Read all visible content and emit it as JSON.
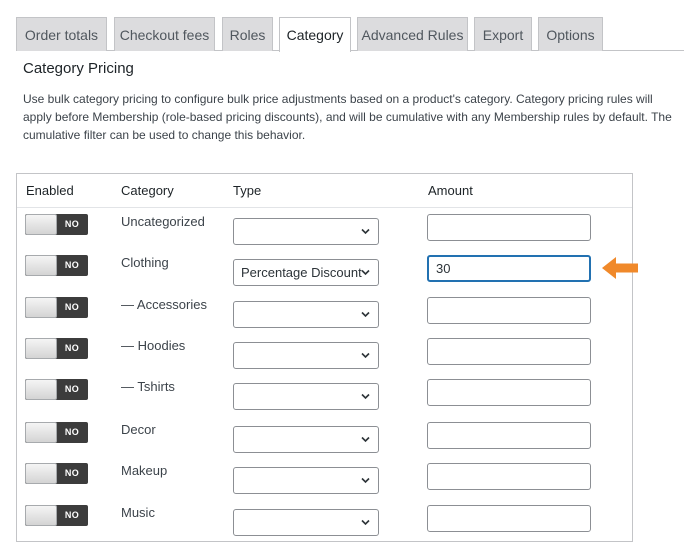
{
  "tabs": [
    {
      "label": "Order totals"
    },
    {
      "label": "Checkout fees"
    },
    {
      "label": "Roles"
    },
    {
      "label": "Category"
    },
    {
      "label": "Advanced Rules"
    },
    {
      "label": "Export"
    },
    {
      "label": "Options"
    }
  ],
  "active_tab": "Category",
  "section": {
    "title": "Category Pricing",
    "description": "Use bulk category pricing to configure bulk price adjustments based on a product's category. Category pricing rules will apply before Membership (role-based pricing discounts), and will be cumulative with any Membership rules by default. The cumulative filter can be used to change this behavior."
  },
  "table": {
    "headers": {
      "enabled": "Enabled",
      "category": "Category",
      "type": "Type",
      "amount": "Amount"
    },
    "toggle_off_label": "NO",
    "rows": [
      {
        "category": "Uncategorized",
        "enabled": false,
        "type": "",
        "amount": ""
      },
      {
        "category": "Clothing",
        "enabled": false,
        "type": "Percentage Discount",
        "amount": "30"
      },
      {
        "category": "— Accessories",
        "enabled": false,
        "type": "",
        "amount": ""
      },
      {
        "category": "— Hoodies",
        "enabled": false,
        "type": "",
        "amount": ""
      },
      {
        "category": "— Tshirts",
        "enabled": false,
        "type": "",
        "amount": ""
      },
      {
        "category": "Decor",
        "enabled": false,
        "type": "",
        "amount": ""
      },
      {
        "category": "Makeup",
        "enabled": false,
        "type": "",
        "amount": ""
      },
      {
        "category": "Music",
        "enabled": false,
        "type": "",
        "amount": ""
      }
    ]
  },
  "colors": {
    "accent_focus": "#2271b1",
    "callout_arrow": "#f0892a",
    "tab_inactive_bg": "#dcdcde",
    "toggle_track": "#3c3c3c"
  },
  "icons": {
    "select_arrow": "chevron-down-icon",
    "callout": "arrow-left-icon"
  }
}
